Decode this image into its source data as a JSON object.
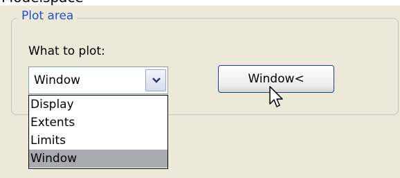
{
  "window": {
    "partial_title": "Modelspace"
  },
  "plot_area": {
    "group_title": "Plot area",
    "what_to_plot_label": "What to plot:",
    "combo": {
      "selected": "Window",
      "options": [
        "Display",
        "Extents",
        "Limits",
        "Window"
      ],
      "highlighted_option": "Window"
    },
    "window_button_label": "Window<"
  },
  "icons": {
    "dropdown_arrow": "chevron-down-icon",
    "pointer": "mouse-cursor-icon"
  },
  "colors": {
    "group_title": "#1f50d6",
    "highlight": "#a9aab0",
    "button_border": "#1a3e86"
  }
}
